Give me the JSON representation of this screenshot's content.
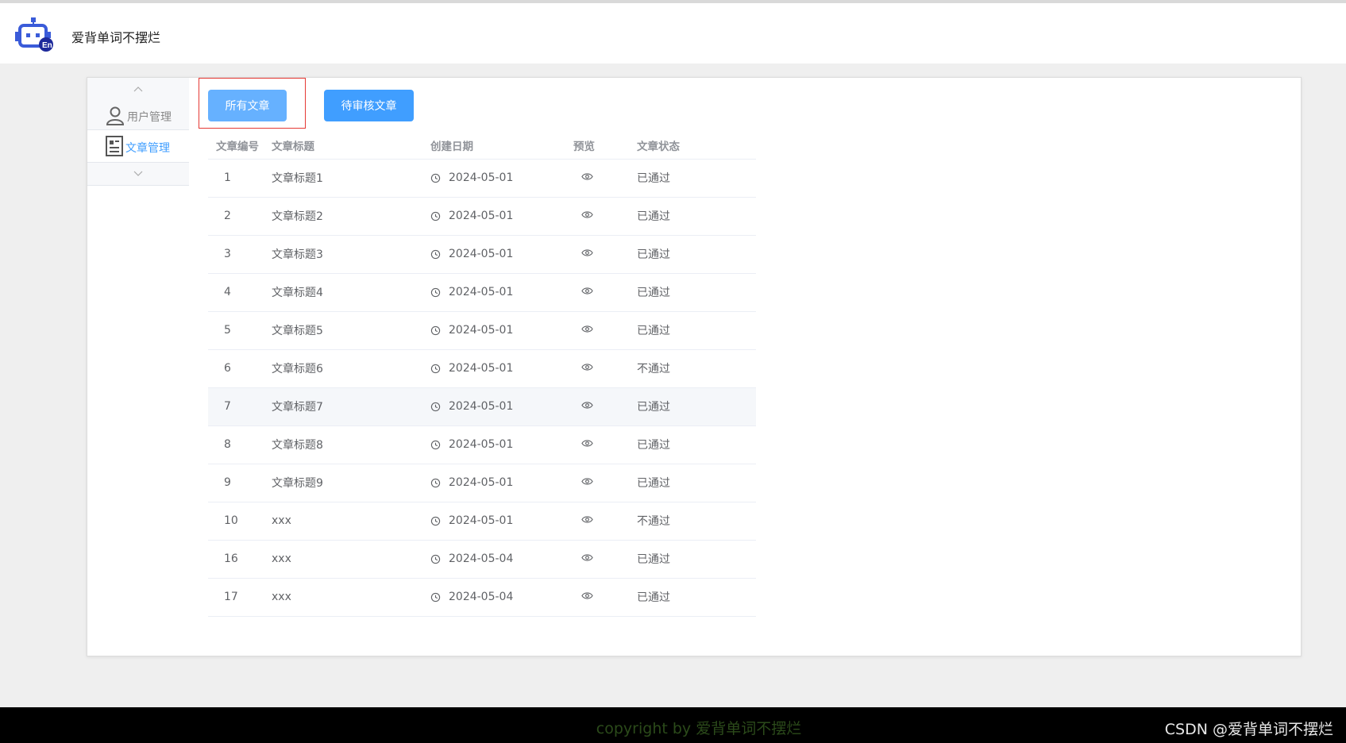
{
  "app": {
    "title": "爱背单词不摆烂",
    "logo_icon": "robot-en-icon"
  },
  "sidebar": {
    "items": [
      {
        "label": "用户管理",
        "icon": "user-icon",
        "active": false
      },
      {
        "label": "文章管理",
        "icon": "document-icon",
        "active": true
      }
    ]
  },
  "toolbar": {
    "all_label": "所有文章",
    "pending_label": "待审核文章"
  },
  "table": {
    "headers": {
      "id": "文章编号",
      "title": "文章标题",
      "date": "创建日期",
      "preview": "预览",
      "status": "文章状态"
    },
    "rows": [
      {
        "id": "1",
        "title": "文章标题1",
        "date": "2024-05-01",
        "status": "已通过"
      },
      {
        "id": "2",
        "title": "文章标题2",
        "date": "2024-05-01",
        "status": "已通过"
      },
      {
        "id": "3",
        "title": "文章标题3",
        "date": "2024-05-01",
        "status": "已通过"
      },
      {
        "id": "4",
        "title": "文章标题4",
        "date": "2024-05-01",
        "status": "已通过"
      },
      {
        "id": "5",
        "title": "文章标题5",
        "date": "2024-05-01",
        "status": "已通过"
      },
      {
        "id": "6",
        "title": "文章标题6",
        "date": "2024-05-01",
        "status": "不通过"
      },
      {
        "id": "7",
        "title": "文章标题7",
        "date": "2024-05-01",
        "status": "已通过"
      },
      {
        "id": "8",
        "title": "文章标题8",
        "date": "2024-05-01",
        "status": "已通过"
      },
      {
        "id": "9",
        "title": "文章标题9",
        "date": "2024-05-01",
        "status": "已通过"
      },
      {
        "id": "10",
        "title": "xxx",
        "date": "2024-05-01",
        "status": "不通过"
      },
      {
        "id": "16",
        "title": "xxx",
        "date": "2024-05-04",
        "status": "已通过"
      },
      {
        "id": "17",
        "title": "xxx",
        "date": "2024-05-04",
        "status": "已通过"
      }
    ]
  },
  "footer": {
    "copyright": "copyright by 爱背单词不摆烂",
    "watermark": "CSDN @爱背单词不摆烂"
  },
  "colors": {
    "primary": "#409eff",
    "primary_light": "#66b1ff",
    "highlight_border": "#e53935",
    "footer_bg": "#000000"
  }
}
